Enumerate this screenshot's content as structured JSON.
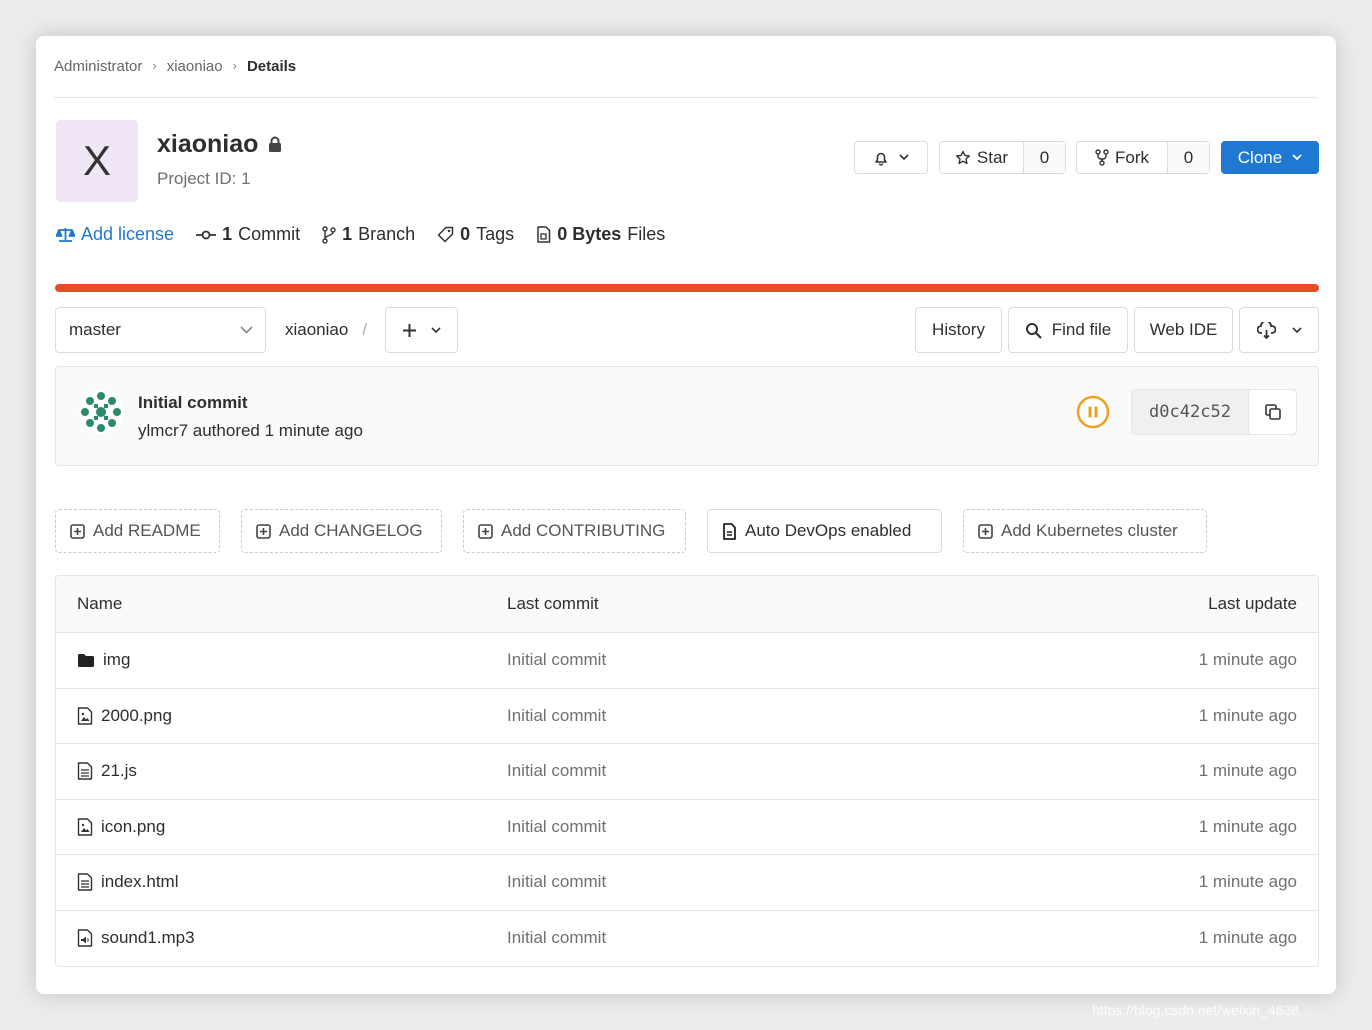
{
  "breadcrumb": [
    "Administrator",
    "xiaoniao",
    "Details"
  ],
  "project": {
    "avatar_letter": "X",
    "name": "xiaoniao",
    "id_text": "Project ID: 1"
  },
  "header_buttons": {
    "star_label": "Star",
    "star_count": "0",
    "fork_label": "Fork",
    "fork_count": "0",
    "clone_label": "Clone"
  },
  "stats": {
    "license": "Add license",
    "commits_count": "1",
    "commits_label": "Commit",
    "branches_count": "1",
    "branches_label": "Branch",
    "tags_count": "0",
    "tags_label": "Tags",
    "size_count": "0 Bytes",
    "size_label": "Files"
  },
  "language_bar": {
    "color": "#e44d26"
  },
  "repo_nav": {
    "branch": "master",
    "path": "xiaoniao",
    "path_sep": "/",
    "history": "History",
    "find_file": "Find file",
    "web_ide": "Web IDE"
  },
  "last_commit": {
    "title": "Initial commit",
    "meta": "ylmcr7 authored 1 minute ago",
    "sha": "d0c42c52"
  },
  "actions": [
    "Add README",
    "Add CHANGELOG",
    "Add CONTRIBUTING",
    "Auto DevOps enabled",
    "Add Kubernetes cluster"
  ],
  "table": {
    "headers": {
      "name": "Name",
      "last_commit": "Last commit",
      "last_update": "Last update"
    },
    "rows": [
      {
        "name": "img",
        "icon": "folder-icon",
        "commit": "Initial commit",
        "update": "1 minute ago"
      },
      {
        "name": "2000.png",
        "icon": "image-file-icon",
        "commit": "Initial commit",
        "update": "1 minute ago"
      },
      {
        "name": "21.js",
        "icon": "text-file-icon",
        "commit": "Initial commit",
        "update": "1 minute ago"
      },
      {
        "name": "icon.png",
        "icon": "image-file-icon",
        "commit": "Initial commit",
        "update": "1 minute ago"
      },
      {
        "name": "index.html",
        "icon": "text-file-icon",
        "commit": "Initial commit",
        "update": "1 minute ago"
      },
      {
        "name": "sound1.mp3",
        "icon": "audio-file-icon",
        "commit": "Initial commit",
        "update": "1 minute ago"
      }
    ]
  },
  "watermark": "https://blog.csdn.net/weixin_4638..."
}
